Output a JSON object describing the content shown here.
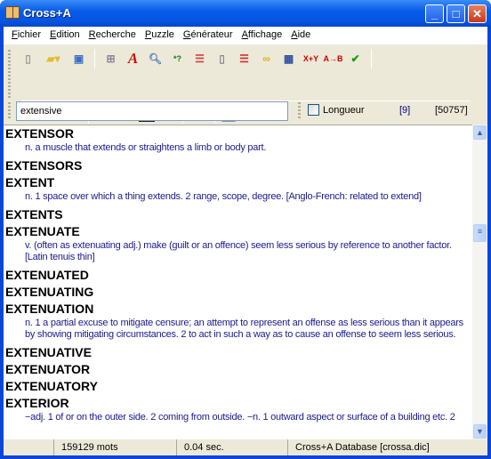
{
  "window": {
    "title": "Cross+A"
  },
  "menu": [
    "Fichier",
    "Edition",
    "Recherche",
    "Puzzle",
    "Générateur",
    "Affichage",
    "Aide"
  ],
  "toolbar1": [
    "new-icon",
    "open-icon",
    "save-icon",
    "structure-icon",
    "anagram-icon",
    "search-icon",
    "wildcard-icon",
    "layout-icon",
    "phone-icon",
    "split-icon",
    "link-icon",
    "grid-icon",
    "equation-icon",
    "transform-icon",
    "check-icon"
  ],
  "toolbar2": [
    "add-word-icon",
    "delete-icon",
    "edit-icon",
    "sudoku-icon",
    "grid-fill-icon",
    "kakuro-icon",
    "crossword-icon",
    "word-ladder-icon",
    "help-icon"
  ],
  "search": {
    "value": "extensive"
  },
  "options": {
    "length_label": "Longueur",
    "length_value": "[9]",
    "count": "[50757]",
    "length_checked": false
  },
  "entries": [
    {
      "word": "EXTENSOR",
      "def": [
        "n. a muscle that extends or straightens a limb or body part."
      ]
    },
    {
      "word": "EXTENSORS",
      "def": []
    },
    {
      "word": "EXTENT",
      "def": [
        "n. 1 space over which a thing extends. 2 range, scope, degree. [Anglo-French: related to extend]"
      ]
    },
    {
      "word": "EXTENTS",
      "def": []
    },
    {
      "word": "EXTENUATE",
      "def": [
        "v. (often as extenuating adj.) make (guilt or an offence) seem less serious by reference to another factor.",
        "[Latin tenuis thin]"
      ]
    },
    {
      "word": "EXTENUATED",
      "def": []
    },
    {
      "word": "EXTENUATING",
      "def": []
    },
    {
      "word": "EXTENUATION",
      "def": [
        "n. 1 a partial excuse to mitigate censure; an attempt to represent an offense as less serious than it appears",
        "by showing mitigating circumstances. 2 to act in such a way as to cause an offense to seem less serious."
      ]
    },
    {
      "word": "EXTENUATIVE",
      "def": []
    },
    {
      "word": "EXTENUATOR",
      "def": []
    },
    {
      "word": "EXTENUATORY",
      "def": []
    },
    {
      "word": "EXTERIOR",
      "def": [
        "−adj. 1 of or on the outer side. 2 coming from outside. −n. 1 outward aspect or surface of a building etc. 2"
      ]
    }
  ],
  "status": {
    "words": "159129 mots",
    "time": "0.04 sec.",
    "database": "Cross+A Database [crossa.dic]"
  }
}
